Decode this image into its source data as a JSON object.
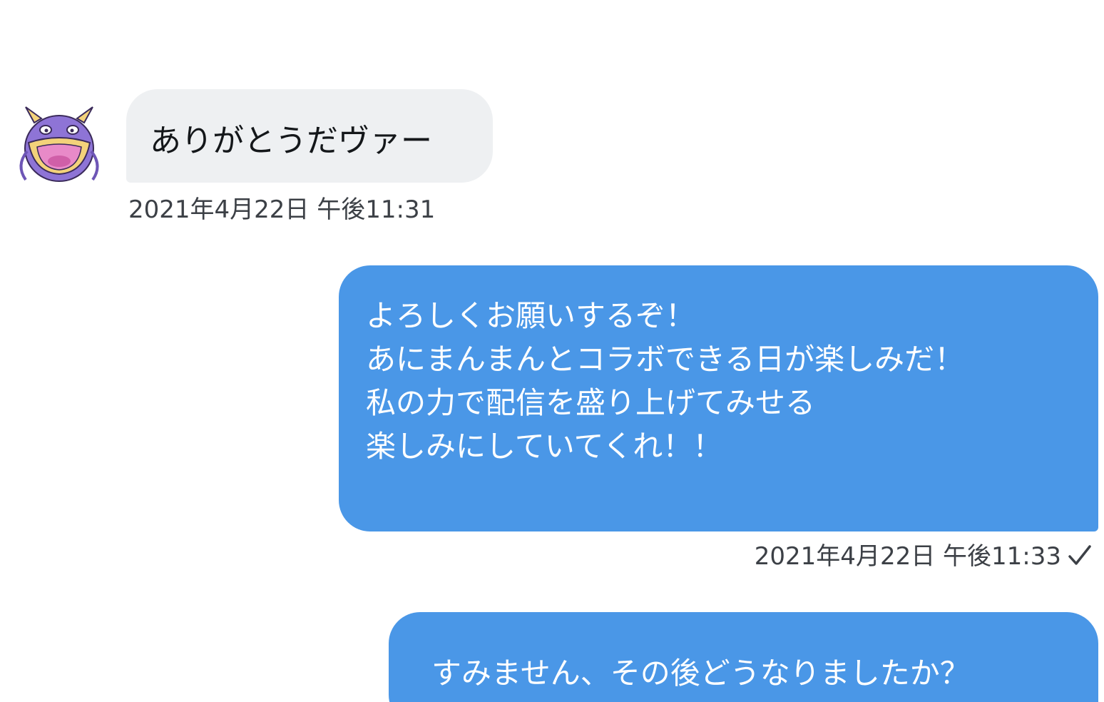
{
  "conversation": {
    "messages": [
      {
        "direction": "incoming",
        "text": "ありがとうだヴァー",
        "timestamp": "2021年4月22日 午後11:31",
        "avatar_icon": "purple-monster-avatar-icon"
      },
      {
        "direction": "outgoing",
        "lines": [
          "よろしくお願いするぞ！",
          "あにまんまんとコラボできる日が楽しみだ！",
          "私の力で配信を盛り上げてみせる",
          "楽しみにしていてくれ！！"
        ],
        "timestamp": "2021年4月22日 午後11:33",
        "status_icon": "checkmark-icon"
      },
      {
        "direction": "outgoing",
        "text": "すみません、その後どうなりましたか？"
      }
    ]
  },
  "colors": {
    "incoming_bubble": "#eef0f2",
    "outgoing_bubble": "#4a97e7",
    "avatar_purple": "#8e74d6",
    "avatar_mouth": "#e88ac8",
    "timestamp_text": "#3c4046"
  }
}
